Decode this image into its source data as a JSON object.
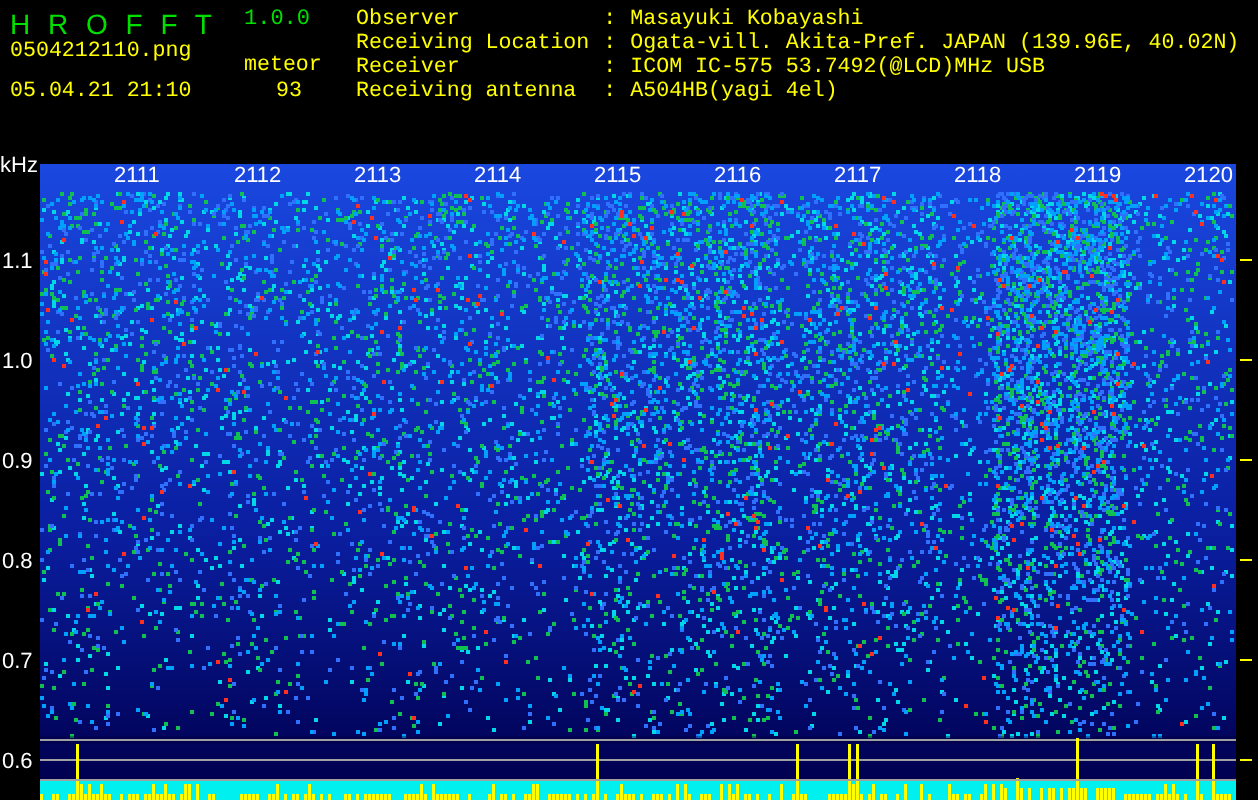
{
  "app": {
    "title": "H R O F F T",
    "version": "1.0.0"
  },
  "file": "0504212110.png",
  "meteor": {
    "label": "meteor",
    "count": "93"
  },
  "datetime": "05.04.21 21:10",
  "separator": ":",
  "info": [
    {
      "label": "Observer",
      "value": "Masayuki Kobayashi"
    },
    {
      "label": "Receiving Location",
      "value": "Ogata-vill. Akita-Pref. JAPAN (139.96E, 40.02N)"
    },
    {
      "label": "Receiver",
      "value": "ICOM IC-575 53.7492(@LCD)MHz USB"
    },
    {
      "label": "Receiving antenna",
      "value": "A504HB(yagi 4el)"
    }
  ],
  "axis": {
    "unit": "kHz",
    "y_labels": [
      "1.1",
      "1.0",
      "0.9",
      "0.8",
      "0.7",
      "0.6"
    ],
    "time_labels": [
      "2111",
      "2112",
      "2113",
      "2114",
      "2115",
      "2116",
      "2117",
      "2118",
      "2119",
      "2120"
    ]
  }
}
